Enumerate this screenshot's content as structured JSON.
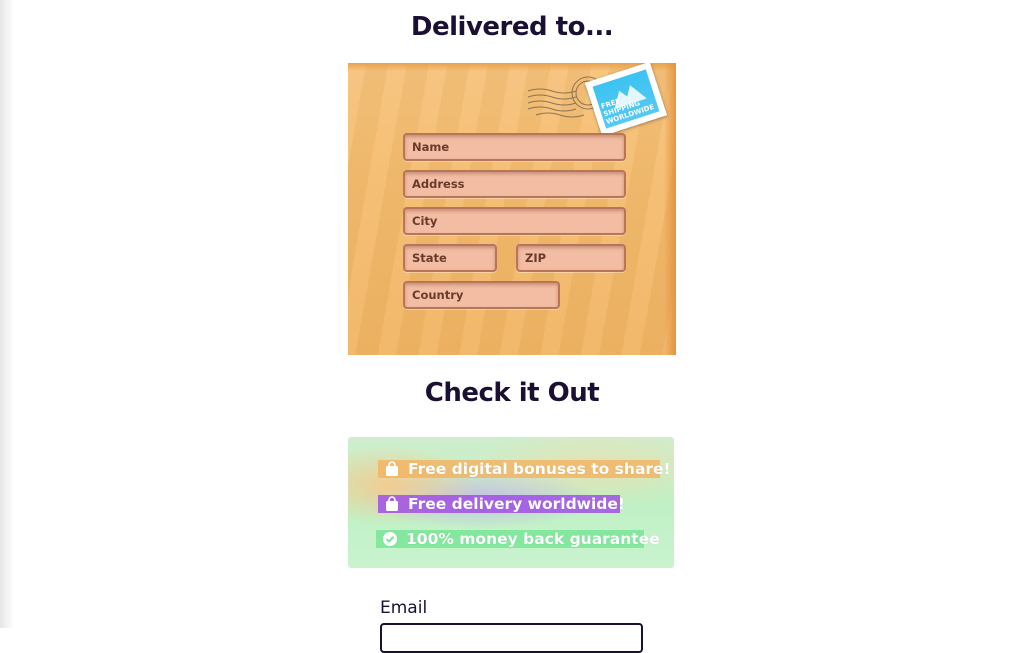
{
  "headings": {
    "delivered": "Delivered to...",
    "checkout": "Check it Out"
  },
  "stamp": {
    "text": "Free Shipping Worldwide",
    "color": "#3cc3f2"
  },
  "address_form": {
    "name_placeholder": "Name",
    "address_placeholder": "Address",
    "city_placeholder": "City",
    "state_placeholder": "State",
    "zip_placeholder": "ZIP",
    "country_placeholder": "Country"
  },
  "benefits": [
    {
      "icon": "bag-icon",
      "label": "Free digital bonuses to share!",
      "color": "#f5af5a"
    },
    {
      "icon": "bag-icon",
      "label": "Free delivery worldwide!",
      "color": "#a050e6"
    },
    {
      "icon": "check-circle-icon",
      "label": "100% money back guarantee",
      "color": "#78e696"
    }
  ],
  "email": {
    "label": "Email",
    "value": ""
  }
}
